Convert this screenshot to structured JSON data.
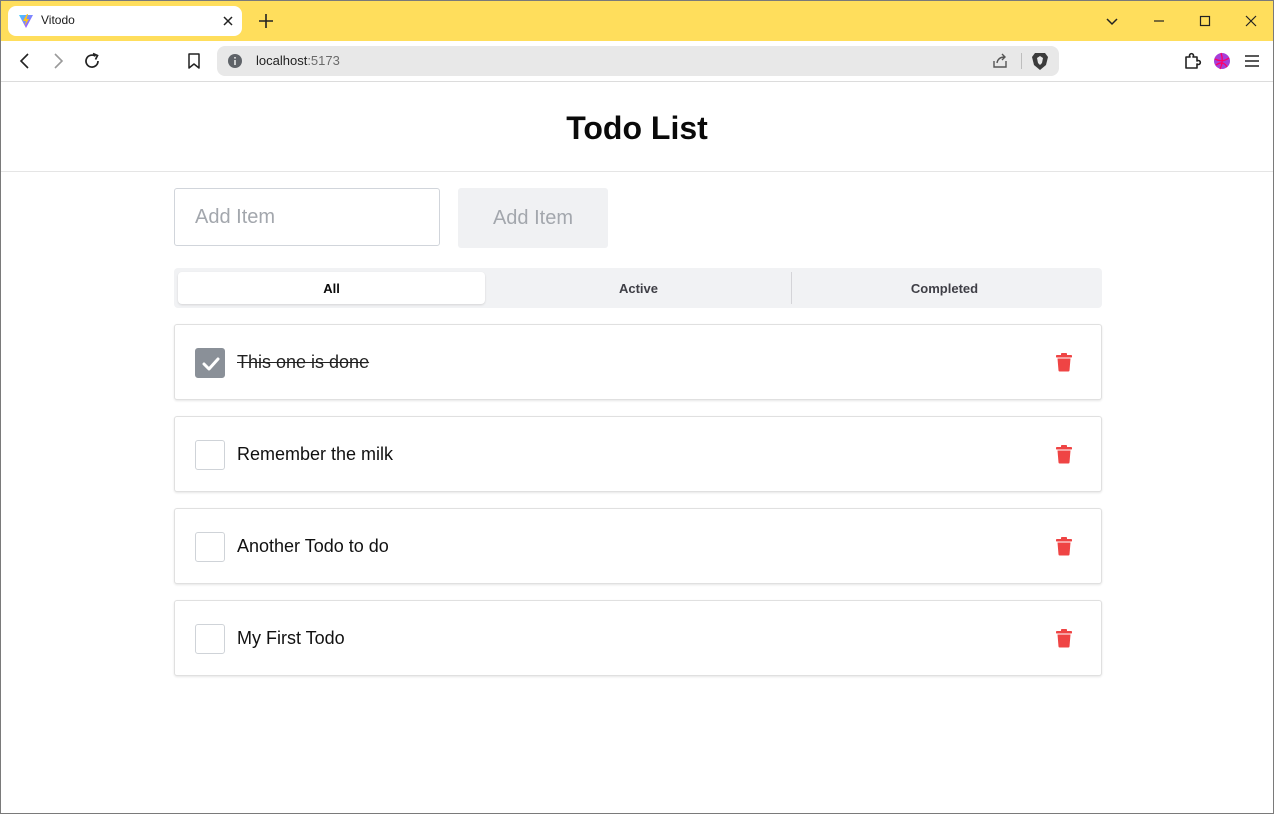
{
  "browser": {
    "tab_title": "Vitodo",
    "url_host": "localhost",
    "url_port": ":5173",
    "theme_color": "#ffde5c"
  },
  "page": {
    "title": "Todo List"
  },
  "add_form": {
    "placeholder": "Add Item",
    "button_label": "Add Item"
  },
  "filters": [
    {
      "label": "All",
      "selected": true
    },
    {
      "label": "Active",
      "selected": false
    },
    {
      "label": "Completed",
      "selected": false
    }
  ],
  "todos": [
    {
      "text": "This one is done",
      "done": true
    },
    {
      "text": "Remember the milk",
      "done": false
    },
    {
      "text": "Another Todo to do",
      "done": false
    },
    {
      "text": "My First Todo",
      "done": false
    }
  ],
  "colors": {
    "delete": "#ef4444",
    "checked_box": "#8a9098"
  }
}
